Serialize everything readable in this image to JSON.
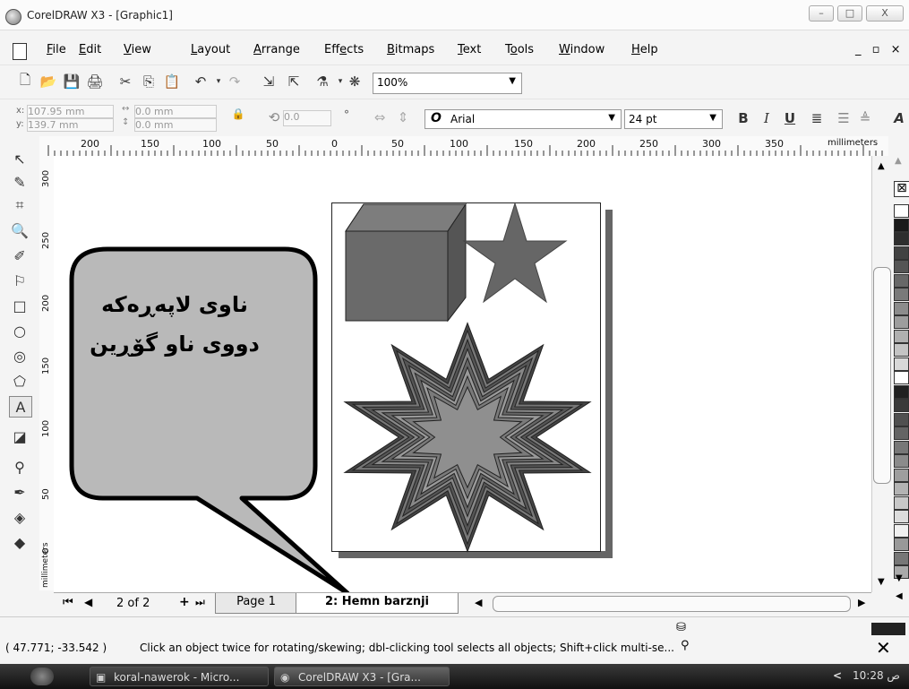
{
  "window": {
    "title": "CorelDRAW X3 - [Graphic1]",
    "minimize": "–",
    "maximize": "□",
    "close": "X"
  },
  "menubar": {
    "items": [
      {
        "label": "File",
        "mnemonic": "F",
        "rest": "ile"
      },
      {
        "label": "Edit",
        "mnemonic": "E",
        "rest": "dit"
      },
      {
        "label": "View",
        "mnemonic": "V",
        "rest": "iew"
      },
      {
        "label": "Layout",
        "mnemonic": "L",
        "rest": "ayout"
      },
      {
        "label": "Arrange",
        "mnemonic": "A",
        "rest": "rrange"
      },
      {
        "label": "Effects",
        "pre": "Eff",
        "mnemonic": "e",
        "rest": "cts"
      },
      {
        "label": "Bitmaps",
        "mnemonic": "B",
        "rest": "itmaps"
      },
      {
        "label": "Text",
        "mnemonic": "T",
        "rest": "ext"
      },
      {
        "label": "Tools",
        "pre": "T",
        "mnemonic": "o",
        "rest": "ols"
      },
      {
        "label": "Window",
        "mnemonic": "W",
        "rest": "indow"
      },
      {
        "label": "Help",
        "mnemonic": "H",
        "rest": "elp"
      }
    ],
    "doc_controls": "_ ▫ ×"
  },
  "standard_toolbar": {
    "zoom_value": "100%",
    "icons": [
      "new-icon",
      "open-icon",
      "save-icon",
      "print-icon",
      "cut-icon",
      "copy-icon",
      "paste-icon",
      "undo-icon",
      "redo-icon",
      "import-icon",
      "export-icon",
      "app-launcher-icon",
      "corel-online-icon"
    ]
  },
  "property_bar": {
    "x_label": "x:",
    "x_value": "107.95 mm",
    "y_label": "y:",
    "y_value": "139.7 mm",
    "w_value": "0.0 mm",
    "h_value": "0.0 mm",
    "angle_value": "0.0",
    "degree": "°",
    "font_name": "Arial",
    "font_size": "24 pt",
    "font_icon": "O"
  },
  "ruler": {
    "top_labels": [
      "200",
      "150",
      "100",
      "50",
      "0",
      "50",
      "100",
      "150",
      "200",
      "250",
      "300",
      "350"
    ],
    "top_unit": "millimeters",
    "left_labels": [
      "300",
      "250",
      "200",
      "150",
      "100",
      "50",
      "0"
    ],
    "left_unit": "millimeters"
  },
  "toolbox": {
    "tools": [
      "pick-tool-icon",
      "shape-tool-icon",
      "crop-tool-icon",
      "zoom-tool-icon",
      "freehand-tool-icon",
      "smart-fill-tool-icon",
      "rectangle-tool-icon",
      "ellipse-tool-icon",
      "spiral-tool-icon",
      "basic-shapes-tool-icon",
      "text-tool-icon",
      "interactive-tool-icon",
      "eyedropper-tool-icon",
      "outline-tool-icon",
      "fill-tool-icon",
      "interactive-fill-tool-icon"
    ]
  },
  "callout": {
    "line1": "ناوی لاپەڕەکە",
    "line2": "دووی ناو گۆڕین"
  },
  "page_nav": {
    "counter": "2 of 2",
    "add_page": "+",
    "tab1": "Page 1",
    "tab2": "2: Hemn barznji"
  },
  "palette": {
    "colors": [
      "#ffffff",
      "#1a1a1a",
      "#2e2e2e",
      "#424242",
      "#555555",
      "#686868",
      "#7a7a7a",
      "#8c8c8c",
      "#9d9d9d",
      "#b0b0b0",
      "#c4c4c4",
      "#d8d8d8",
      "#ffffff",
      "#202020",
      "#3a3a3a",
      "#505050",
      "#646464",
      "#787878",
      "#8b8b8b",
      "#9e9e9e",
      "#b3b3b3",
      "#c8c8c8",
      "#dcdcdc",
      "#f0f0f0",
      "#999999",
      "#777777",
      "#aaaaaa"
    ]
  },
  "status": {
    "coords": "( 47.771; -33.542 )",
    "hint": "Click an object twice for rotating/skewing; dbl-clicking tool selects all objects; Shift+click multi-se..."
  },
  "taskbar": {
    "task1": "koral-nawerok - Micro...",
    "task2": "CorelDRAW X3 - [Gra...",
    "clock": "10:28 ص",
    "chevron": "<"
  }
}
